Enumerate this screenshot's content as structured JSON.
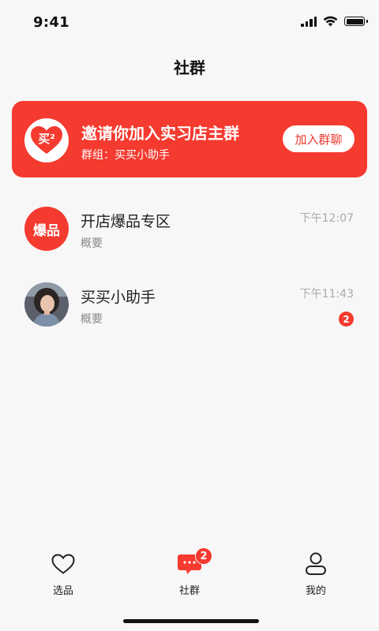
{
  "status_bar": {
    "time": "9:41"
  },
  "header": {
    "title": "社群"
  },
  "banner": {
    "logo_text": "买²",
    "title": "邀请你加入实习店主群",
    "subtitle": "群组：买买小助手",
    "join_label": "加入群聊",
    "color": "#f53a2f"
  },
  "chats": [
    {
      "avatar_text": "爆品",
      "name": "开店爆品专区",
      "preview": "概要",
      "time": "下午12:07"
    },
    {
      "avatar": "photo-avatar",
      "name": "买买小助手",
      "preview": "概要",
      "time": "下午11:43",
      "unread": "2"
    }
  ],
  "tabs": [
    {
      "label": "选品",
      "icon": "heart-icon"
    },
    {
      "label": "社群",
      "icon": "chat-bubble-icon",
      "badge": "2",
      "active": true
    },
    {
      "label": "我的",
      "icon": "user-icon"
    }
  ],
  "colors": {
    "accent": "#f53a2f",
    "background": "#f7f7f7"
  }
}
